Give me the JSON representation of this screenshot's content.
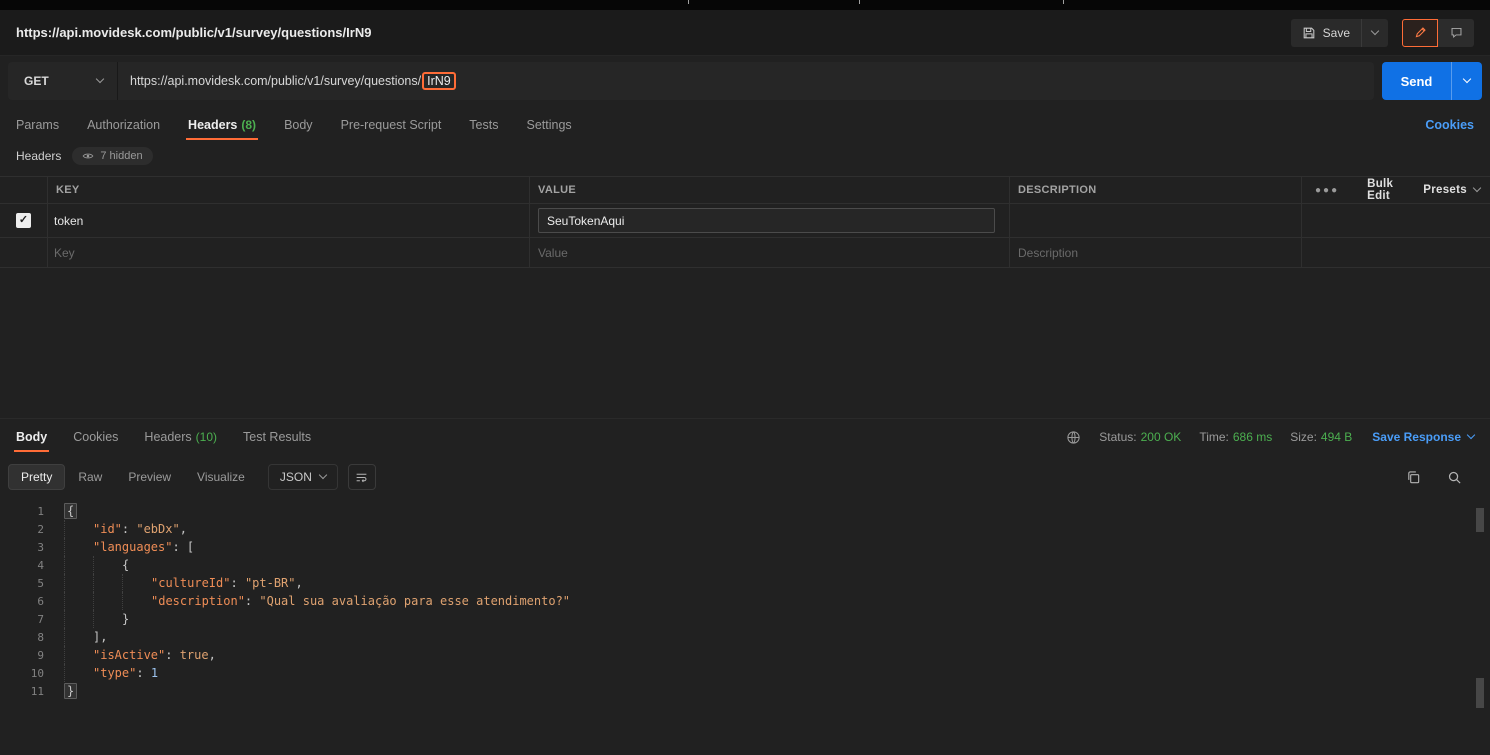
{
  "colors": {
    "accent_orange": "#ff6c37",
    "success_green": "#4caf50",
    "link_blue": "#4a9df8",
    "send_blue": "#1071e5"
  },
  "titlebar": {
    "title": "https://api.movidesk.com/public/v1/survey/questions/IrN9",
    "save_label": "Save"
  },
  "request_bar": {
    "method": "GET",
    "url_prefix": "https://api.movidesk.com/public/v1/survey/questions/",
    "url_highlighted": "IrN9",
    "send_label": "Send"
  },
  "request_tabs": {
    "tabs": [
      {
        "label": "Params",
        "count": ""
      },
      {
        "label": "Authorization",
        "count": ""
      },
      {
        "label": "Headers",
        "count": "(8)"
      },
      {
        "label": "Body",
        "count": ""
      },
      {
        "label": "Pre-request Script",
        "count": ""
      },
      {
        "label": "Tests",
        "count": ""
      },
      {
        "label": "Settings",
        "count": ""
      }
    ],
    "cookies_link": "Cookies"
  },
  "headers_editor": {
    "title": "Headers",
    "hidden_label": "7 hidden",
    "columns": {
      "key": "KEY",
      "value": "VALUE",
      "description": "DESCRIPTION"
    },
    "bulk_edit_label": "Bulk Edit",
    "presets_label": "Presets",
    "rows": [
      {
        "key": "token",
        "value": "SeuTokenAqui",
        "description": "",
        "checked": true
      }
    ],
    "placeholders": {
      "key": "Key",
      "value": "Value",
      "description": "Description"
    }
  },
  "response": {
    "tabs": [
      {
        "label": "Body",
        "count": ""
      },
      {
        "label": "Cookies",
        "count": ""
      },
      {
        "label": "Headers",
        "count": "(10)"
      },
      {
        "label": "Test Results",
        "count": ""
      }
    ],
    "meta": {
      "status_label": "Status:",
      "status_value": "200 OK",
      "time_label": "Time:",
      "time_value": "686 ms",
      "size_label": "Size:",
      "size_value": "494 B",
      "save_response_label": "Save Response"
    },
    "view_tabs": [
      {
        "label": "Pretty"
      },
      {
        "label": "Raw"
      },
      {
        "label": "Preview"
      },
      {
        "label": "Visualize"
      }
    ],
    "format_select": "JSON"
  },
  "response_body": {
    "lines": [
      {
        "n": 1,
        "indent": 0,
        "tokens": [
          {
            "t": "brace",
            "v": "{"
          }
        ]
      },
      {
        "n": 2,
        "indent": 1,
        "tokens": [
          {
            "t": "key",
            "v": "\"id\""
          },
          {
            "t": "punc",
            "v": ": "
          },
          {
            "t": "str",
            "v": "\"ebDx\""
          },
          {
            "t": "punc",
            "v": ","
          }
        ]
      },
      {
        "n": 3,
        "indent": 1,
        "tokens": [
          {
            "t": "key",
            "v": "\"languages\""
          },
          {
            "t": "punc",
            "v": ": ["
          }
        ]
      },
      {
        "n": 4,
        "indent": 2,
        "tokens": [
          {
            "t": "punc",
            "v": "{"
          }
        ]
      },
      {
        "n": 5,
        "indent": 3,
        "tokens": [
          {
            "t": "key",
            "v": "\"cultureId\""
          },
          {
            "t": "punc",
            "v": ": "
          },
          {
            "t": "str",
            "v": "\"pt-BR\""
          },
          {
            "t": "punc",
            "v": ","
          }
        ]
      },
      {
        "n": 6,
        "indent": 3,
        "tokens": [
          {
            "t": "key",
            "v": "\"description\""
          },
          {
            "t": "punc",
            "v": ": "
          },
          {
            "t": "str",
            "v": "\"Qual sua avaliação para esse atendimento?\""
          }
        ]
      },
      {
        "n": 7,
        "indent": 2,
        "tokens": [
          {
            "t": "punc",
            "v": "}"
          }
        ]
      },
      {
        "n": 8,
        "indent": 1,
        "tokens": [
          {
            "t": "punc",
            "v": "],"
          }
        ]
      },
      {
        "n": 9,
        "indent": 1,
        "tokens": [
          {
            "t": "key",
            "v": "\"isActive\""
          },
          {
            "t": "punc",
            "v": ": "
          },
          {
            "t": "bool",
            "v": "true"
          },
          {
            "t": "punc",
            "v": ","
          }
        ]
      },
      {
        "n": 10,
        "indent": 1,
        "tokens": [
          {
            "t": "key",
            "v": "\"type\""
          },
          {
            "t": "punc",
            "v": ": "
          },
          {
            "t": "num",
            "v": "1"
          }
        ]
      },
      {
        "n": 11,
        "indent": 0,
        "tokens": [
          {
            "t": "brace",
            "v": "}"
          }
        ]
      }
    ]
  }
}
